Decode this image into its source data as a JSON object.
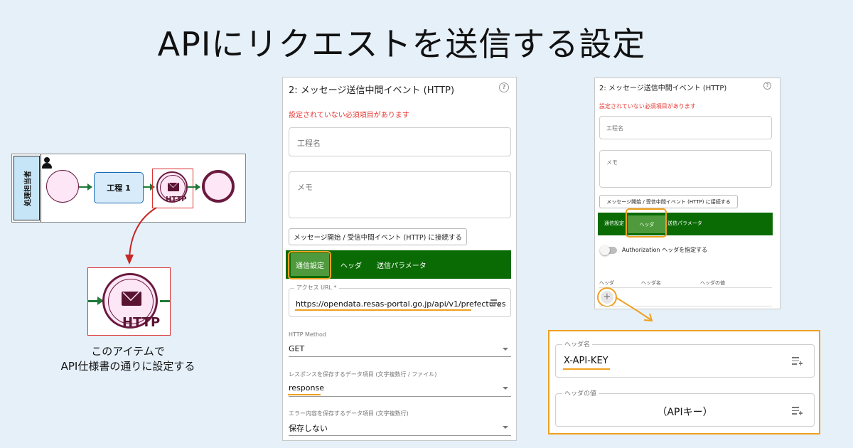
{
  "title": "APIにリクエストを送信する設定",
  "diagram": {
    "lane_label": "処理担当者",
    "task_label": "工程 1",
    "event_label": "HTTP"
  },
  "zoom_event_label": "HTTP",
  "caption": {
    "line1": "このアイテムで",
    "line2": "API仕様書の通りに設定する"
  },
  "panel1": {
    "title": "2: メッセージ送信中間イベント (HTTP)",
    "help": "?",
    "warning": "設定されていない必須項目があります",
    "step_name_placeholder": "工程名",
    "memo_placeholder": "メモ",
    "connect_button": "メッセージ開始 / 受信中間イベント (HTTP) に接続する",
    "tabs": [
      "通信設定",
      "ヘッダ",
      "送信パラメータ"
    ],
    "access_url": {
      "label": "アクセス URL *",
      "value": "https://opendata.resas-portal.go.jp/api/v1/prefectures"
    },
    "http_method": {
      "label": "HTTP Method",
      "value": "GET"
    },
    "response_field": {
      "label": "レスポンスを保存するデータ項目 (文字複数行 / ファイル)",
      "value": "response"
    },
    "error_field": {
      "label": "エラー内容を保存するデータ項目 (文字複数行)",
      "value": "保存しない"
    }
  },
  "panel2": {
    "title": "2: メッセージ送信中間イベント (HTTP)",
    "help": "?",
    "warning": "設定されていない必須項目があります",
    "step_name_placeholder": "工程名",
    "memo_placeholder": "メモ",
    "connect_button": "メッセージ開始 / 受信中間イベント (HTTP) に接続する",
    "tabs": [
      "通信設定",
      "ヘッダ",
      "送信パラメータ"
    ],
    "auth_toggle_label": "Authorization ヘッダを指定する",
    "columns": [
      "ヘッダ",
      "ヘッダ名",
      "ヘッダの値"
    ],
    "add": "+"
  },
  "header_zoom": {
    "name": {
      "label": "ヘッダ名",
      "value": "X-API-KEY"
    },
    "value": {
      "label": "ヘッダの値",
      "value": "（APIキー）"
    }
  },
  "colors": {
    "tab_bar": "#0a6b05",
    "active_tab": "#4e9a3c",
    "highlight": "#f0a020",
    "warning": "#e53935",
    "event_border": "#6a1a3e"
  }
}
